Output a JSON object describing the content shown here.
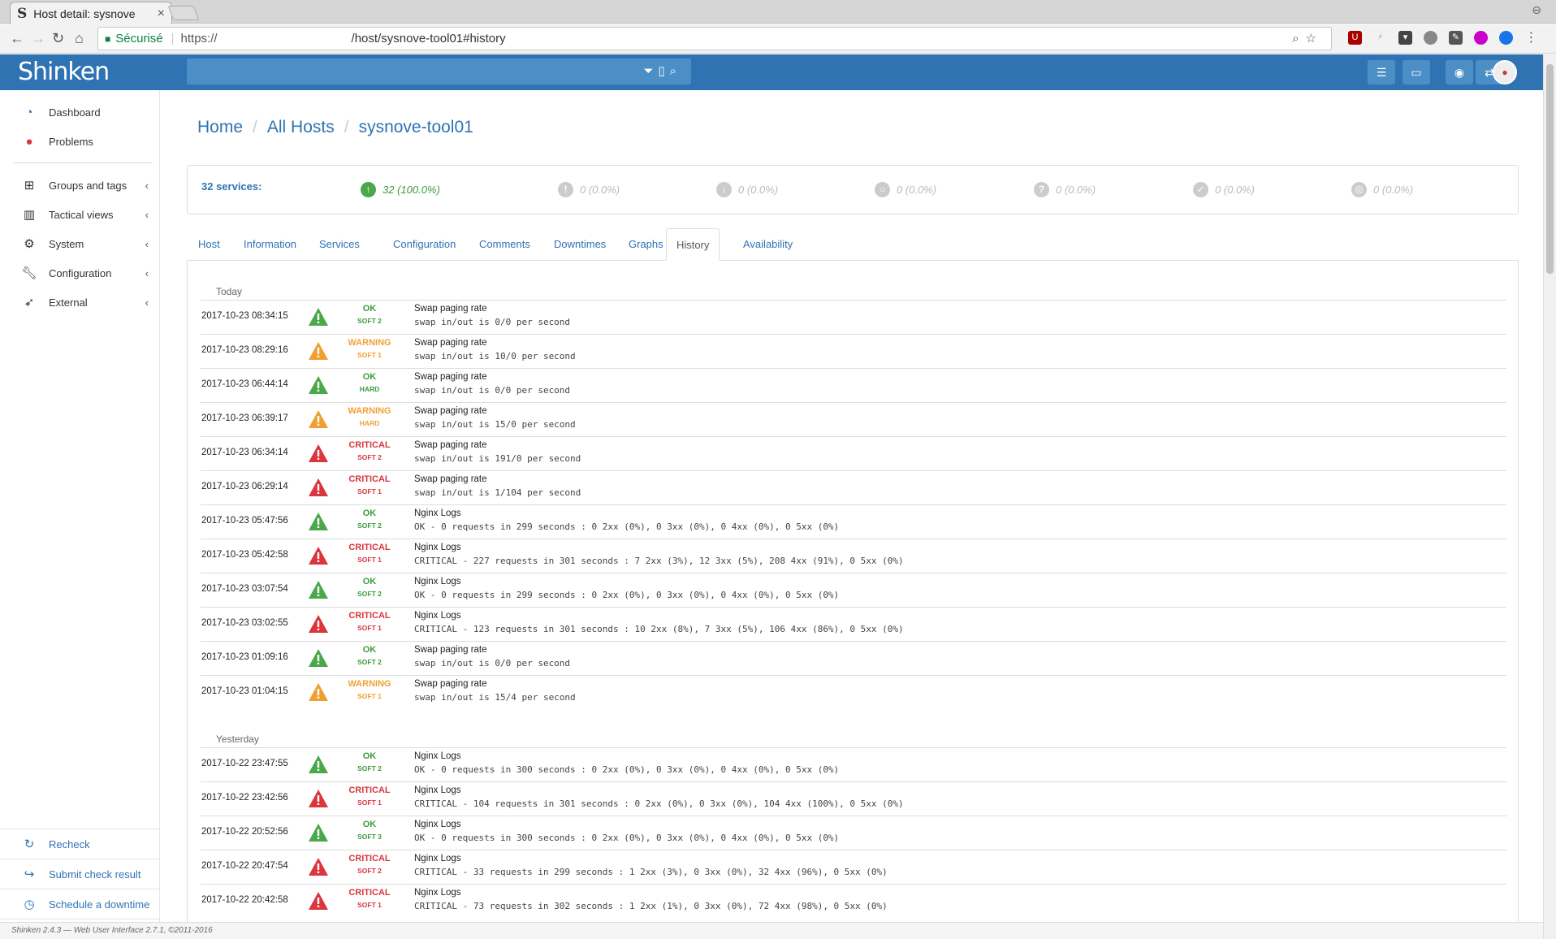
{
  "browser": {
    "tab_title": "Host detail: sysnove",
    "tab_close": "×",
    "secure_label": "Sécurisé",
    "url_scheme": "https://",
    "url_path": "/host/sysnove-tool01#history"
  },
  "app": {
    "logo": "Shinken"
  },
  "sidebar": {
    "items": [
      {
        "label": "Dashboard",
        "icon": "dashboard-icon"
      },
      {
        "label": "Problems",
        "icon": "alert-icon"
      },
      {
        "label": "Groups and tags",
        "icon": "sitemap-icon"
      },
      {
        "label": "Tactical views",
        "icon": "bar-chart-icon"
      },
      {
        "label": "System",
        "icon": "gears-icon"
      },
      {
        "label": "Configuration",
        "icon": "wrench-icon"
      },
      {
        "label": "External",
        "icon": "rocket-icon"
      }
    ],
    "actions": [
      {
        "label": "Recheck",
        "icon": "refresh-icon"
      },
      {
        "label": "Submit check result",
        "icon": "share-icon"
      },
      {
        "label": "Schedule a downtime",
        "icon": "clock-icon"
      }
    ]
  },
  "breadcrumb": [
    "Home",
    "All Hosts",
    "sysnove-tool01"
  ],
  "summary": {
    "label": "32 services:",
    "stats": [
      {
        "text": "32 (100.0%)",
        "state": "ok"
      },
      {
        "text": "0 (0.0%)",
        "state": "warning"
      },
      {
        "text": "0 (0.0%)",
        "state": "critical"
      },
      {
        "text": "0 (0.0%)",
        "state": "pending"
      },
      {
        "text": "0 (0.0%)",
        "state": "unknown"
      },
      {
        "text": "0 (0.0%)",
        "state": "ack"
      },
      {
        "text": "0 (0.0%)",
        "state": "downtime"
      }
    ]
  },
  "tabs": [
    "Host",
    "Information",
    "Services",
    "Configuration",
    "Comments",
    "Downtimes",
    "Graphs",
    "History",
    "Availability"
  ],
  "active_tab": "History",
  "history": {
    "today_label": "Today",
    "yesterday_label": "Yesterday",
    "today": [
      {
        "date": "2017-10-23 08:34:15",
        "state": "OK",
        "type": "SOFT 2",
        "service": "Swap paging rate",
        "output": "swap in/out is 0/0 per second"
      },
      {
        "date": "2017-10-23 08:29:16",
        "state": "WARNING",
        "type": "SOFT 1",
        "service": "Swap paging rate",
        "output": "swap in/out is 10/0 per second"
      },
      {
        "date": "2017-10-23 06:44:14",
        "state": "OK",
        "type": "HARD",
        "service": "Swap paging rate",
        "output": "swap in/out is 0/0 per second"
      },
      {
        "date": "2017-10-23 06:39:17",
        "state": "WARNING",
        "type": "HARD",
        "service": "Swap paging rate",
        "output": "swap in/out is 15/0 per second"
      },
      {
        "date": "2017-10-23 06:34:14",
        "state": "CRITICAL",
        "type": "SOFT 2",
        "service": "Swap paging rate",
        "output": "swap in/out is 191/0 per second"
      },
      {
        "date": "2017-10-23 06:29:14",
        "state": "CRITICAL",
        "type": "SOFT 1",
        "service": "Swap paging rate",
        "output": "swap in/out is 1/104 per second"
      },
      {
        "date": "2017-10-23 05:47:56",
        "state": "OK",
        "type": "SOFT 2",
        "service": "Nginx Logs",
        "output": "OK - 0 requests in 299 seconds : 0 2xx (0%), 0 3xx (0%), 0 4xx (0%), 0 5xx (0%)"
      },
      {
        "date": "2017-10-23 05:42:58",
        "state": "CRITICAL",
        "type": "SOFT 1",
        "service": "Nginx Logs",
        "output": "CRITICAL - 227 requests in 301 seconds : 7 2xx (3%), 12 3xx (5%), 208 4xx (91%), 0 5xx (0%)"
      },
      {
        "date": "2017-10-23 03:07:54",
        "state": "OK",
        "type": "SOFT 2",
        "service": "Nginx Logs",
        "output": "OK - 0 requests in 299 seconds : 0 2xx (0%), 0 3xx (0%), 0 4xx (0%), 0 5xx (0%)"
      },
      {
        "date": "2017-10-23 03:02:55",
        "state": "CRITICAL",
        "type": "SOFT 1",
        "service": "Nginx Logs",
        "output": "CRITICAL - 123 requests in 301 seconds : 10 2xx (8%), 7 3xx (5%), 106 4xx (86%), 0 5xx (0%)"
      },
      {
        "date": "2017-10-23 01:09:16",
        "state": "OK",
        "type": "SOFT 2",
        "service": "Swap paging rate",
        "output": "swap in/out is 0/0 per second"
      },
      {
        "date": "2017-10-23 01:04:15",
        "state": "WARNING",
        "type": "SOFT 1",
        "service": "Swap paging rate",
        "output": "swap in/out is 15/4 per second"
      }
    ],
    "yesterday": [
      {
        "date": "2017-10-22 23:47:55",
        "state": "OK",
        "type": "SOFT 2",
        "service": "Nginx Logs",
        "output": "OK - 0 requests in 300 seconds : 0 2xx (0%), 0 3xx (0%), 0 4xx (0%), 0 5xx (0%)"
      },
      {
        "date": "2017-10-22 23:42:56",
        "state": "CRITICAL",
        "type": "SOFT 1",
        "service": "Nginx Logs",
        "output": "CRITICAL - 104 requests in 301 seconds : 0 2xx (0%), 0 3xx (0%), 104 4xx (100%), 0 5xx (0%)"
      },
      {
        "date": "2017-10-22 20:52:56",
        "state": "OK",
        "type": "SOFT 3",
        "service": "Nginx Logs",
        "output": "OK - 0 requests in 300 seconds : 0 2xx (0%), 0 3xx (0%), 0 4xx (0%), 0 5xx (0%)"
      },
      {
        "date": "2017-10-22 20:47:54",
        "state": "CRITICAL",
        "type": "SOFT 2",
        "service": "Nginx Logs",
        "output": "CRITICAL - 33 requests in 299 seconds : 1 2xx (3%), 0 3xx (0%), 32 4xx (96%), 0 5xx (0%)"
      },
      {
        "date": "2017-10-22 20:42:58",
        "state": "CRITICAL",
        "type": "SOFT 1",
        "service": "Nginx Logs",
        "output": "CRITICAL - 73 requests in 302 seconds : 1 2xx (1%), 0 3xx (0%), 72 4xx (98%), 0 5xx (0%)"
      }
    ]
  },
  "footer": "Shinken 2.4.3 — Web User Interface 2.7.1, ©2011-2016",
  "colors": {
    "header": "#2f73b3",
    "ok": "#4aa84a",
    "warning": "#f0a032",
    "critical": "#d9363e"
  }
}
